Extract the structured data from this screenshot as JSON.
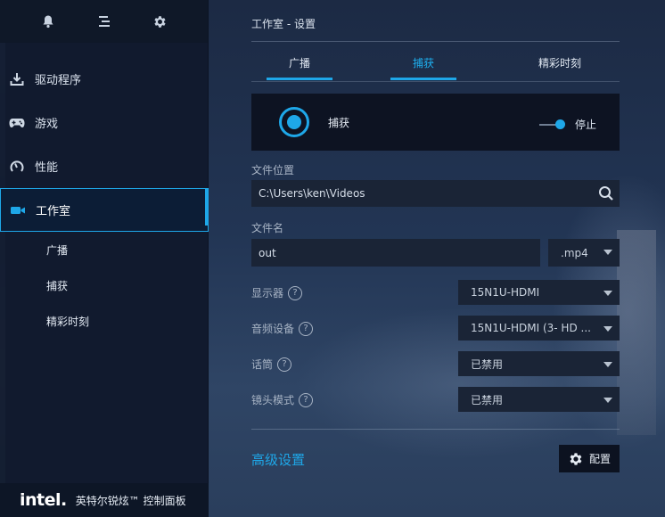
{
  "sidebar": {
    "topbar": [
      {
        "icon": "bell-icon"
      },
      {
        "icon": "menu-icon"
      },
      {
        "icon": "gear-icon"
      }
    ],
    "items": [
      {
        "label": "驱动程序",
        "icon": "download-icon"
      },
      {
        "label": "游戏",
        "icon": "gamepad-icon"
      },
      {
        "label": "性能",
        "icon": "gauge-icon"
      },
      {
        "label": "工作室",
        "icon": "video-camera-icon",
        "active": true
      }
    ],
    "sub_items": [
      "广播",
      "捕获",
      "精彩时刻"
    ],
    "footer": {
      "logo": "intel.",
      "title": "英特尔锐炫™ 控制面板"
    }
  },
  "main": {
    "breadcrumb": "工作室 - 设置",
    "tabs": [
      {
        "label": "广播",
        "active": false
      },
      {
        "label": "捕获",
        "active": true
      },
      {
        "label": "精彩时刻",
        "active": false
      }
    ],
    "capture": {
      "label": "捕获",
      "toggle_label": "停止"
    },
    "file_location": {
      "label": "文件位置",
      "value": "C:\\Users\\ken\\Videos"
    },
    "file_name": {
      "label": "文件名",
      "value": "out",
      "extension": ".mp4"
    },
    "display": {
      "label": "显示器",
      "value": "15N1U-HDMI"
    },
    "audio_device": {
      "label": "音频设备",
      "value": "15N1U-HDMI (3- HD ..."
    },
    "microphone": {
      "label": "话筒",
      "value": "已禁用"
    },
    "camera_mode": {
      "label": "镜头模式",
      "value": "已禁用"
    },
    "advanced_label": "高级设置",
    "config_label": "配置"
  },
  "colors": {
    "accent": "#1ea7e8",
    "sidebar_bg": "#10192c",
    "card_bg": "#0d1322",
    "field_bg": "#1a2436"
  }
}
